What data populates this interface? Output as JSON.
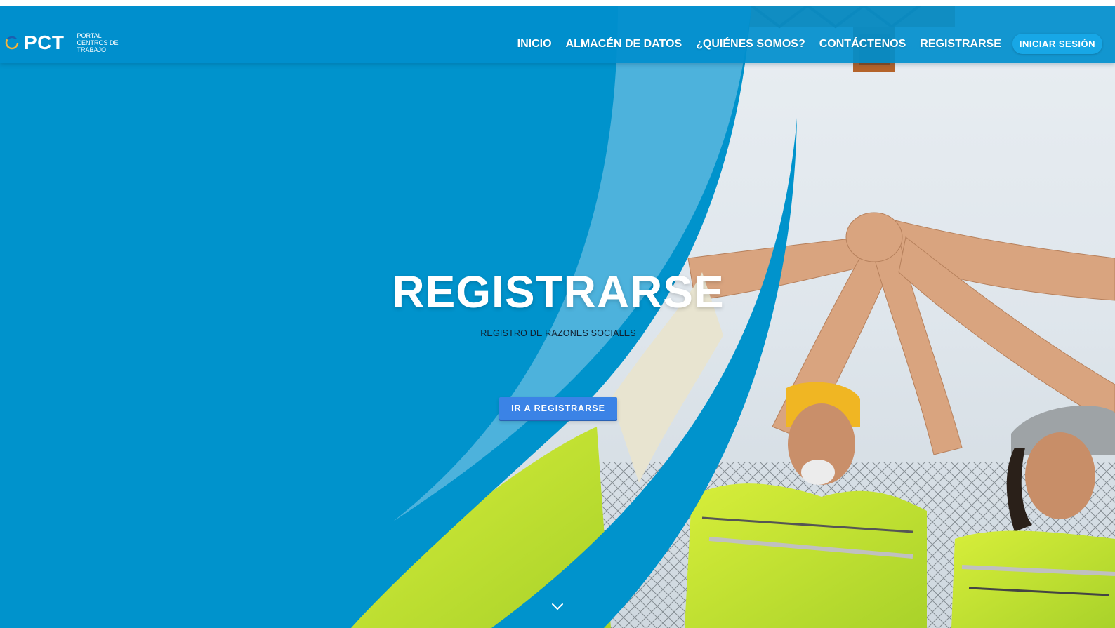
{
  "brand": {
    "name": "PCT",
    "subtitle": "PORTAL CENTROS DE TRABAJO",
    "accent_color": "#0093cc",
    "logo_icon": "swirl-logo-icon"
  },
  "nav": {
    "items": [
      {
        "label": "INICIO"
      },
      {
        "label": "ALMACÉN DE DATOS"
      },
      {
        "label": "¿QUIÉNES SOMOS?"
      },
      {
        "label": "CONTÁCTENOS"
      },
      {
        "label": "REGISTRARSE"
      }
    ],
    "login_label": "INICIAR SESIÓN"
  },
  "hero": {
    "title": "REGISTRARSE",
    "subtitle": "REGISTRO DE RAZONES SOCIALES",
    "cta_label": "IR A REGISTRARSE",
    "scroll_icon": "chevron-down-icon"
  }
}
